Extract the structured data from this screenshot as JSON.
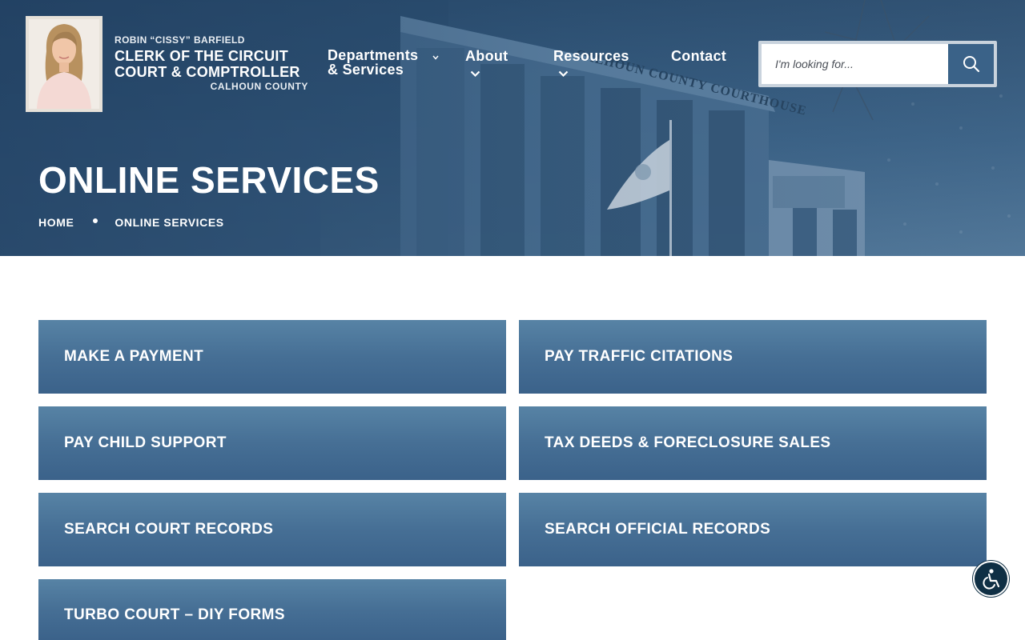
{
  "header": {
    "brand_top": "ROBIN “CISSY” BARFIELD",
    "brand_line1": "CLERK OF THE CIRCUIT",
    "brand_line2": "COURT & COMPTROLLER",
    "brand_county": "CALHOUN COUNTY",
    "nav": [
      {
        "label_line1": "Departments",
        "label_line2": "& Services"
      },
      {
        "label": "About"
      },
      {
        "label": "Resources"
      },
      {
        "label": "Contact"
      }
    ],
    "search": {
      "placeholder": "I'm looking for..."
    }
  },
  "hero": {
    "title": "ONLINE SERVICES",
    "breadcrumb": [
      "HOME",
      "ONLINE SERVICES"
    ],
    "sign_text": "CALHOUN COUNTY COURTHOUSE"
  },
  "services": [
    "MAKE A PAYMENT",
    "PAY TRAFFIC CITATIONS",
    "PAY CHILD SUPPORT",
    "TAX DEEDS & FORECLOSURE SALES",
    "SEARCH COURT RECORDS",
    "SEARCH OFFICIAL RECORDS",
    "TURBO COURT – DIY FORMS"
  ],
  "colors": {
    "tile": "#466f95",
    "search_button": "#3a6288",
    "a11y_button": "#0f2f44"
  },
  "icons": {
    "search": "search-icon",
    "accessibility": "accessibility-icon",
    "chevron": "chevron-down-icon"
  }
}
